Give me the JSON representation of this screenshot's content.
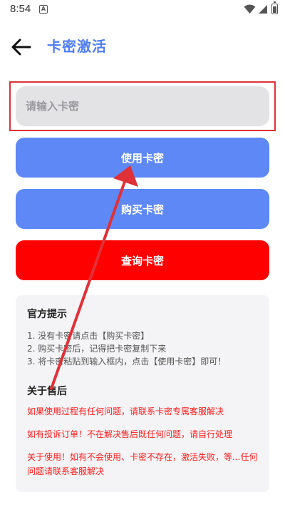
{
  "status_bar": {
    "time": "8:54",
    "app_badge": "A"
  },
  "header": {
    "title": "卡密激活"
  },
  "input": {
    "placeholder": "请输入卡密",
    "value": ""
  },
  "buttons": {
    "use": "使用卡密",
    "buy": "购买卡密",
    "query": "查询卡密"
  },
  "tips": {
    "title": "官方提示",
    "items": [
      "1. 没有卡密请点击【购买卡密】",
      "2. 购买卡密后，记得把卡密复制下来",
      "3. 将卡密粘贴到输入框内，点击【使用卡密】即可！"
    ]
  },
  "after_sales": {
    "title": "关于售后",
    "notices": [
      "如果使用过程有任何问题，请联系卡密专属客服解决",
      "如有投诉订单！不在解决售后既任何问题，请自行处理",
      "关于使用！如有不会使用、卡密不存在，激活失败，等...任何问题请联系客服解决"
    ]
  },
  "colors": {
    "accent_blue": "#5e88f6",
    "title_blue": "#4f7df2",
    "danger_red": "#ff0000",
    "annotation_red": "#e03138"
  }
}
